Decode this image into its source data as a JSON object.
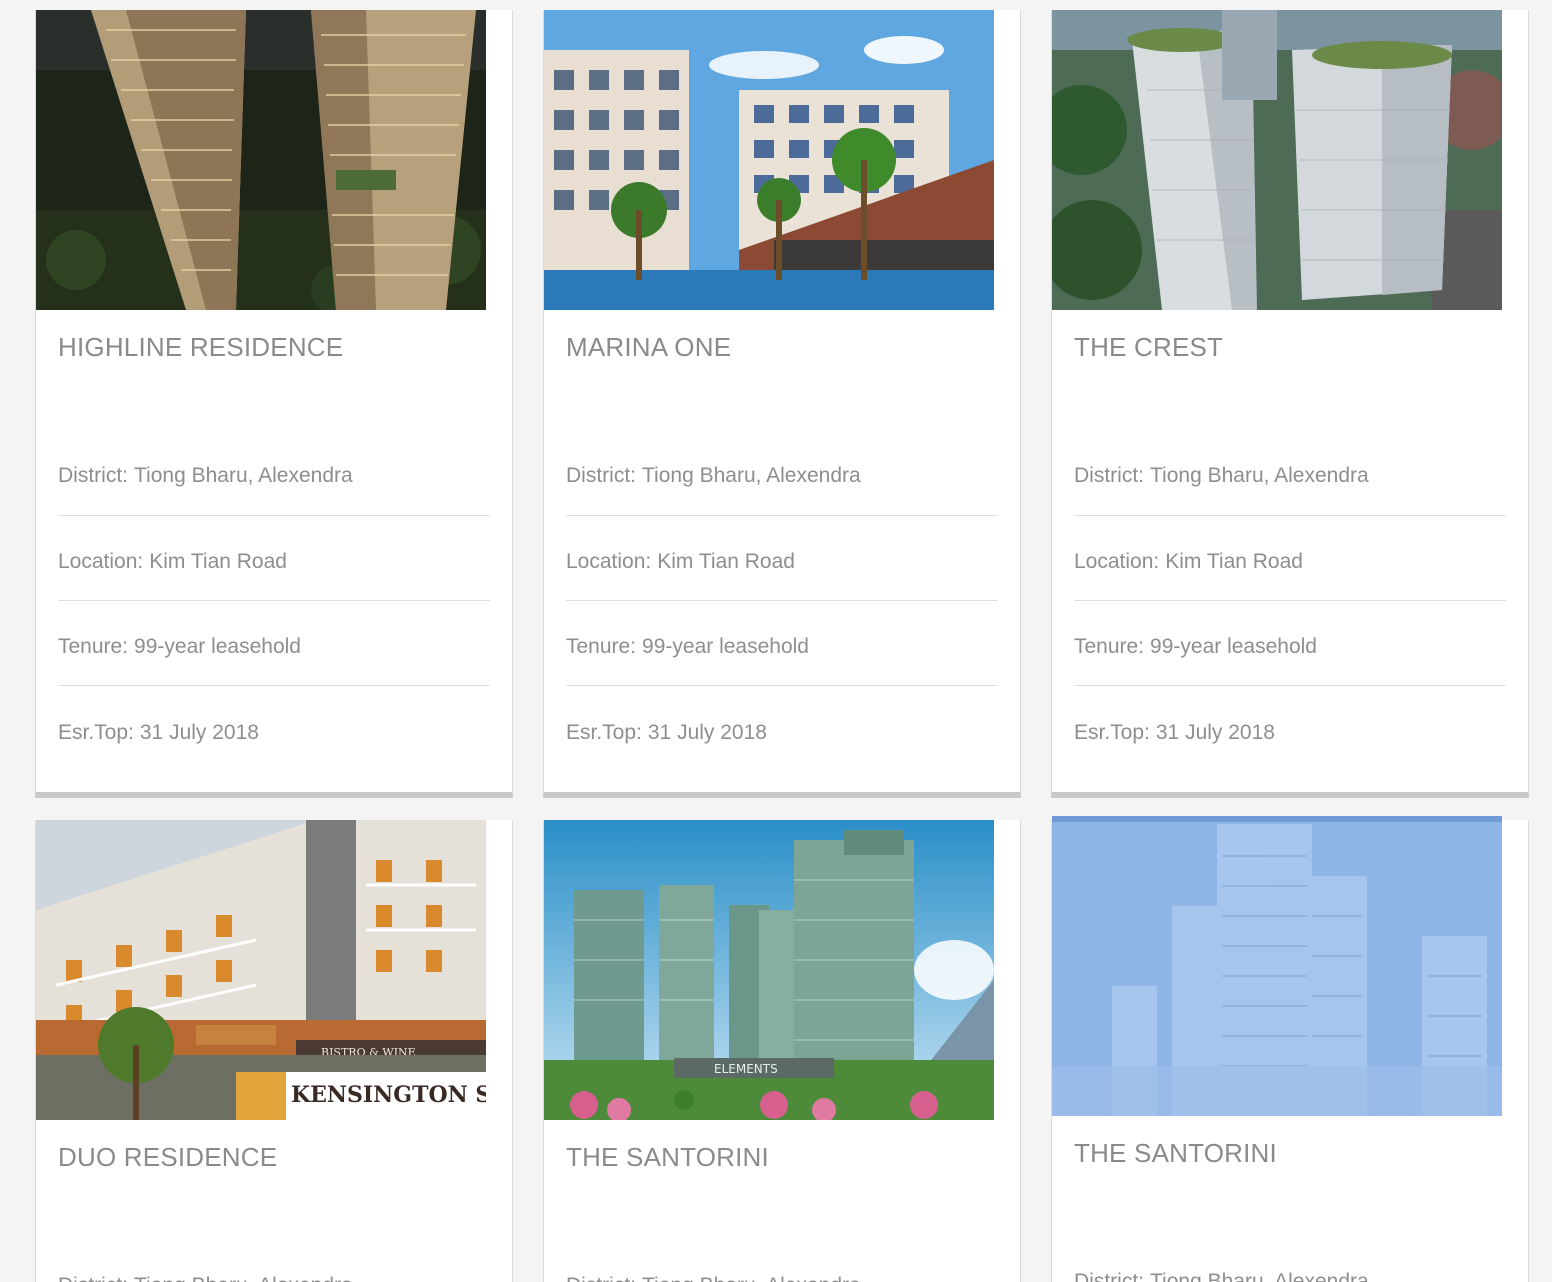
{
  "properties": [
    {
      "name": "HIGHLINE RESIDENCE",
      "district_label": "District:",
      "district": "Tiong Bharu, Alexendra",
      "location_label": "Location:",
      "location": "Kim Tian Road",
      "tenure_label": "Tenure:",
      "tenure": "99-year leasehold",
      "top_label": "Esr.Top:",
      "top": "31 July 2018"
    },
    {
      "name": "MARINA ONE",
      "district_label": "District:",
      "district": "Tiong Bharu, Alexendra",
      "location_label": "Location:",
      "location": "Kim Tian Road",
      "tenure_label": "Tenure:",
      "tenure": "99-year leasehold",
      "top_label": "Esr.Top:",
      "top": "31 July 2018"
    },
    {
      "name": "THE CREST",
      "district_label": "District:",
      "district": "Tiong Bharu, Alexendra",
      "location_label": "Location:",
      "location": "Kim Tian Road",
      "tenure_label": "Tenure:",
      "tenure": "99-year leasehold",
      "top_label": "Esr.Top:",
      "top": "31 July 2018"
    },
    {
      "name": "DUO RESIDENCE",
      "district_label": "District:",
      "district": "Tiong Bharu, Alexendra",
      "sign_text": "KENSINGTON SQUARE",
      "shop_text": "BISTRO & WINE"
    },
    {
      "name": "THE SANTORINI",
      "district_label": "District:",
      "district": "Tiong Bharu, Alexendra",
      "sign_text": "ELEMENTS"
    },
    {
      "name": "THE SANTORINI",
      "district_label": "District:",
      "district": "Tiong Bharu, Alexendra"
    }
  ]
}
